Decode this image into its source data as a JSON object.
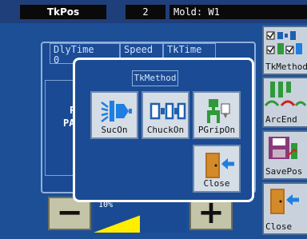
{
  "topbar": {
    "title": "TkPos",
    "number": "2",
    "mold": "Mold: W1"
  },
  "background": {
    "tabs": [
      "DlyTime\n0",
      "Speed",
      "TkTime"
    ],
    "letters": [
      "P",
      "PA"
    ],
    "speed_percent": "10%",
    "speed_level": 0.5
  },
  "controls": {
    "minus": "−",
    "plus": "+"
  },
  "right_menu": [
    {
      "label": "TkMethod",
      "icon": "method-icon"
    },
    {
      "label": "ArcEnd",
      "icon": "arc-end-icon"
    },
    {
      "label": "SavePos",
      "icon": "save-pos-icon"
    },
    {
      "label": "Close",
      "icon": "close-door-icon"
    }
  ],
  "modal": {
    "title": "TkMethod",
    "buttons": [
      {
        "label": "SucOn",
        "icon": "suction-icon"
      },
      {
        "label": "ChuckOn",
        "icon": "chuck-icon"
      },
      {
        "label": "PGripOn",
        "icon": "gripper-icon"
      },
      {
        "label": "Close",
        "icon": "close-door-icon"
      }
    ]
  },
  "colors": {
    "background": "#1d4f97",
    "button_face": "#d5dde6",
    "accent_green": "#2f9a3a",
    "accent_blue": "#1f7fe0"
  }
}
